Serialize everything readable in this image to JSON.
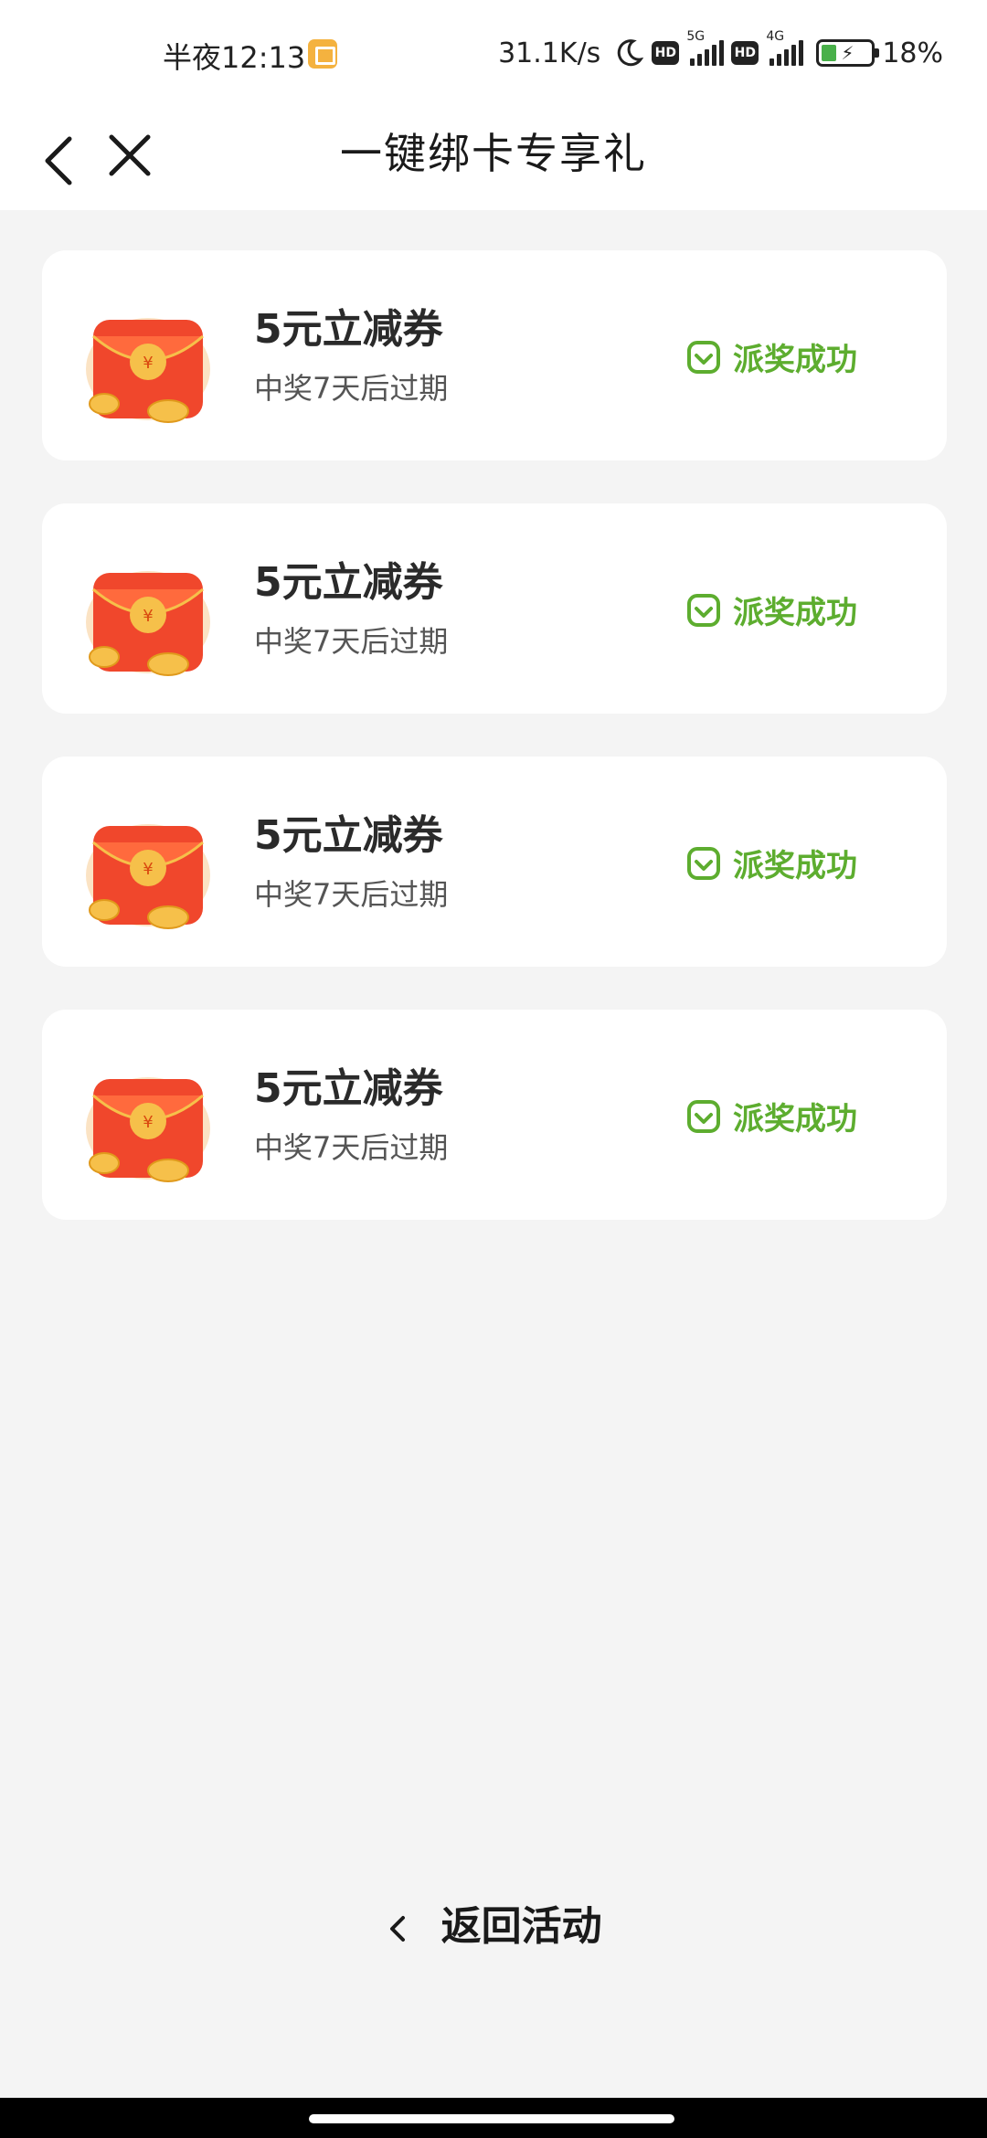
{
  "status_bar": {
    "time": "半夜12:13",
    "speed": "31.1K/s",
    "hd": "HD",
    "net_5g": "5G",
    "net_4g": "4G",
    "battery": "18%"
  },
  "header": {
    "title": "一键绑卡专享礼"
  },
  "cards": [
    {
      "title": "5元立减券",
      "subtitle": "中奖7天后过期",
      "status": "派奖成功"
    },
    {
      "title": "5元立减券",
      "subtitle": "中奖7天后过期",
      "status": "派奖成功"
    },
    {
      "title": "5元立减券",
      "subtitle": "中奖7天后过期",
      "status": "派奖成功"
    },
    {
      "title": "5元立减券",
      "subtitle": "中奖7天后过期",
      "status": "派奖成功"
    }
  ],
  "footer": {
    "return_label": "返回活动"
  },
  "colors": {
    "accent_green": "#5dad2f",
    "red_envelope": "#f0472c",
    "gold": "#f6c04a"
  },
  "icons": {
    "back": "back-arrow-icon",
    "close": "close-icon",
    "envelope": "red-envelope-icon",
    "success": "check-shield-icon"
  }
}
